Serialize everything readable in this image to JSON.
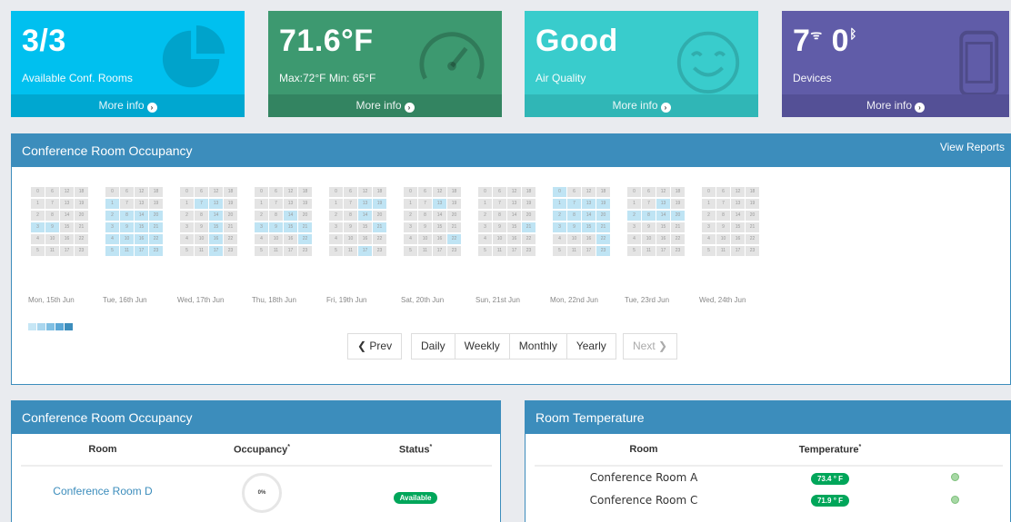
{
  "tiles": [
    {
      "value": "3/3",
      "label": "Available Conf. Rooms",
      "more": "More info",
      "icon": "pie-chart-icon",
      "color": "#00c0ef"
    },
    {
      "value": "71.6°F",
      "label": "Max:72°F Min: 65°F",
      "more": "More info",
      "icon": "gauge-icon",
      "color": "#3d9970"
    },
    {
      "value": "Good",
      "label": "Air Quality",
      "more": "More info",
      "icon": "smiley-icon",
      "color": "#39cccc"
    },
    {
      "value_a": "7",
      "value_b": "0",
      "label": "Devices",
      "more": "More info",
      "icon": "phone-icon",
      "color": "#605ca8"
    }
  ],
  "occupancy": {
    "title": "Conference Room Occupancy",
    "view_reports": "View Reports",
    "days": [
      {
        "label": "Mon, 15th Jun",
        "active": [
          3,
          9
        ]
      },
      {
        "label": "Tue, 16th Jun",
        "active": [
          1,
          2,
          3,
          4,
          5,
          8,
          9,
          10,
          11,
          14,
          15,
          16,
          17,
          20,
          21,
          22,
          23
        ]
      },
      {
        "label": "Wed, 17th Jun",
        "active": [
          7,
          13,
          14,
          15,
          16,
          17
        ]
      },
      {
        "label": "Thu, 18th Jun",
        "active": [
          3,
          9,
          14,
          15,
          21,
          22
        ]
      },
      {
        "label": "Fri, 19th Jun",
        "active": [
          13,
          14,
          17,
          19,
          21
        ]
      },
      {
        "label": "Sat, 20th Jun",
        "active": [
          13,
          22
        ]
      },
      {
        "label": "Sun, 21st Jun",
        "active": [
          21
        ]
      },
      {
        "label": "Mon, 22nd Jun",
        "active": [
          0,
          1,
          2,
          3,
          7,
          8,
          9,
          13,
          14,
          15,
          19,
          20,
          21,
          22,
          23
        ]
      },
      {
        "label": "Tue, 23rd Jun",
        "active": [
          2,
          8,
          13,
          14,
          20
        ]
      },
      {
        "label": "Wed, 24th Jun",
        "active": []
      }
    ],
    "legend_colors": [
      "#c6e6f5",
      "#a9d6ee",
      "#7fbfe3",
      "#5aa7d6",
      "#3c8dbc"
    ],
    "pager": {
      "prev": "Prev",
      "daily": "Daily",
      "weekly": "Weekly",
      "monthly": "Monthly",
      "yearly": "Yearly",
      "next": "Next"
    }
  },
  "occ_table": {
    "title": "Conference Room Occupancy",
    "headers": {
      "room": "Room",
      "occupancy": "Occupancy",
      "status": "Status"
    },
    "rows": [
      {
        "room": "Conference Room D",
        "occupancy": "0%",
        "status": "Available"
      }
    ]
  },
  "temp_table": {
    "title": "Room Temperature",
    "headers": {
      "room": "Room",
      "temperature": "Temperature"
    },
    "rows": [
      {
        "room": "Conference Room A",
        "temperature": "73.4 ° F"
      },
      {
        "room": "Conference Room C",
        "temperature": "71.9 ° F"
      }
    ]
  }
}
